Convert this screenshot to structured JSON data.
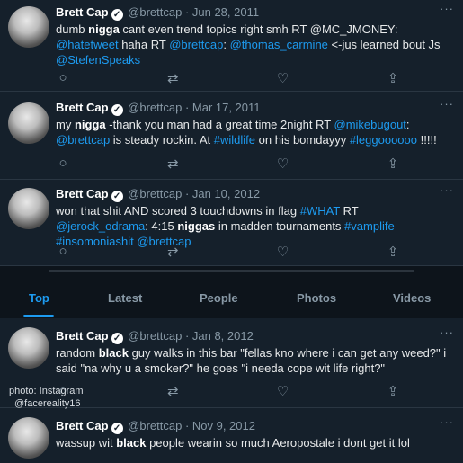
{
  "tweets": [
    {
      "name": "Brett Cap",
      "handle": "@brettcap",
      "date": "· Jun 28, 2011",
      "segments": [
        {
          "t": "dumb "
        },
        {
          "t": "nigga",
          "b": true
        },
        {
          "t": " cant even trend topics right smh RT @MC_JMONEY: "
        },
        {
          "t": "@hatetweet",
          "link": true
        },
        {
          "t": " haha RT "
        },
        {
          "t": "@brettcap",
          "link": true
        },
        {
          "t": ": "
        },
        {
          "t": "@thomas_carmine",
          "link": true
        },
        {
          "t": " <-jus learned bout Js "
        },
        {
          "t": "@StefenSpeaks",
          "link": true
        }
      ]
    },
    {
      "name": "Brett Cap",
      "handle": "@brettcap",
      "date": "· Mar 17, 2011",
      "segments": [
        {
          "t": "my "
        },
        {
          "t": "nigga",
          "b": true
        },
        {
          "t": " -thank you man had a great time 2night RT "
        },
        {
          "t": "@mikebugout",
          "link": true
        },
        {
          "t": ": "
        },
        {
          "t": "@brettcap",
          "link": true
        },
        {
          "t": " is steady rockin. At "
        },
        {
          "t": "#wildlife",
          "link": true
        },
        {
          "t": " on his bomdayyy "
        },
        {
          "t": "#leggoooooo",
          "link": true
        },
        {
          "t": " !!!!!"
        }
      ]
    },
    {
      "name": "Brett Cap",
      "handle": "@brettcap",
      "date": "· Jan 10, 2012",
      "segments": [
        {
          "t": "won that shit AND scored 3 touchdowns in flag "
        },
        {
          "t": "#WHAT",
          "link": true
        },
        {
          "t": " RT "
        },
        {
          "t": "@jerock_odrama",
          "link": true
        },
        {
          "t": ": 4:15 "
        },
        {
          "t": "niggas",
          "b": true
        },
        {
          "t": " in madden tournaments "
        },
        {
          "t": "#vamplife",
          "link": true
        },
        {
          "t": " "
        },
        {
          "t": "#insomoniashit",
          "link": true
        },
        {
          "t": " "
        },
        {
          "t": "@brettcap",
          "link": true
        }
      ]
    },
    {
      "name": "Brett Cap",
      "handle": "@brettcap",
      "date": "· Jan 8, 2012",
      "segments": [
        {
          "t": "random "
        },
        {
          "t": "black",
          "b": true
        },
        {
          "t": " guy walks in this bar \"fellas kno where i can get any weed?\" i said \"na why u a smoker?\" he goes \"i needa cope wit life right?\""
        }
      ]
    },
    {
      "name": "Brett Cap",
      "handle": "@brettcap",
      "date": "· Nov 9, 2012",
      "segments": [
        {
          "t": "wassup wit "
        },
        {
          "t": "black",
          "b": true
        },
        {
          "t": " people wearin so much Aeropostale i dont get it lol"
        }
      ]
    }
  ],
  "tabs": [
    "Top",
    "Latest",
    "People",
    "Photos",
    "Videos"
  ],
  "active_tab": "Top",
  "icons": {
    "reply": "○",
    "retweet": "⇄",
    "like": "♡",
    "share": "⇪",
    "more": "···",
    "verified": "✓"
  },
  "watermark": {
    "line1": "photo: Instagram",
    "line2": "@facereality16"
  },
  "colors": {
    "background": "#15202b",
    "link": "#1d9bf0",
    "muted": "#8899a6"
  }
}
